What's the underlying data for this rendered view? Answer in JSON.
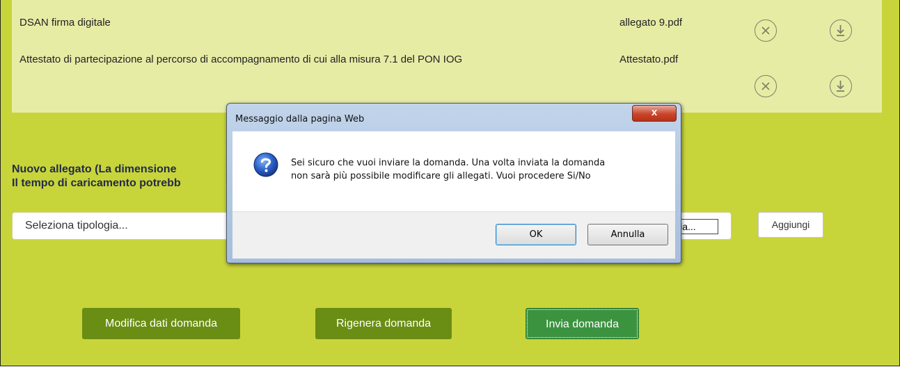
{
  "attachments": [
    {
      "name": "DSAN firma digitale",
      "file": "allegato 9.pdf"
    },
    {
      "name": "Attestato di partecipazione al percorso di accompagnamento di cui alla misura 7.1 del PON IOG",
      "file": "Attestato.pdf"
    }
  ],
  "icons": {
    "remove": "circle-x-icon",
    "download": "download-icon"
  },
  "new_attachment": {
    "title_line1": "Nuovo allegato (La dimensione",
    "title_line2": "Il tempo di caricamento potrebb",
    "select_placeholder": "Seleziona tipologia...",
    "browse_label": "lia...",
    "add_label": "Aggiungi"
  },
  "actions": {
    "modify_label": "Modifica dati domanda",
    "regenerate_label": "Rigenera domanda",
    "send_label": "Invia domanda"
  },
  "dialog": {
    "title": "Messaggio dalla pagina Web",
    "close_label": "x",
    "message_line1": "Sei sicuro che vuoi inviare la domanda. Una volta inviata la domanda",
    "message_line2": "non sarà più possibile modificare gli allegati. Vuoi procedere Si/No",
    "ok_label": "OK",
    "cancel_label": "Annulla"
  },
  "colors": {
    "page_bg": "#c8d53a",
    "panel_bg": "#e7eca5",
    "button_green": "#6a8d13",
    "button_primary": "#3b9340"
  }
}
